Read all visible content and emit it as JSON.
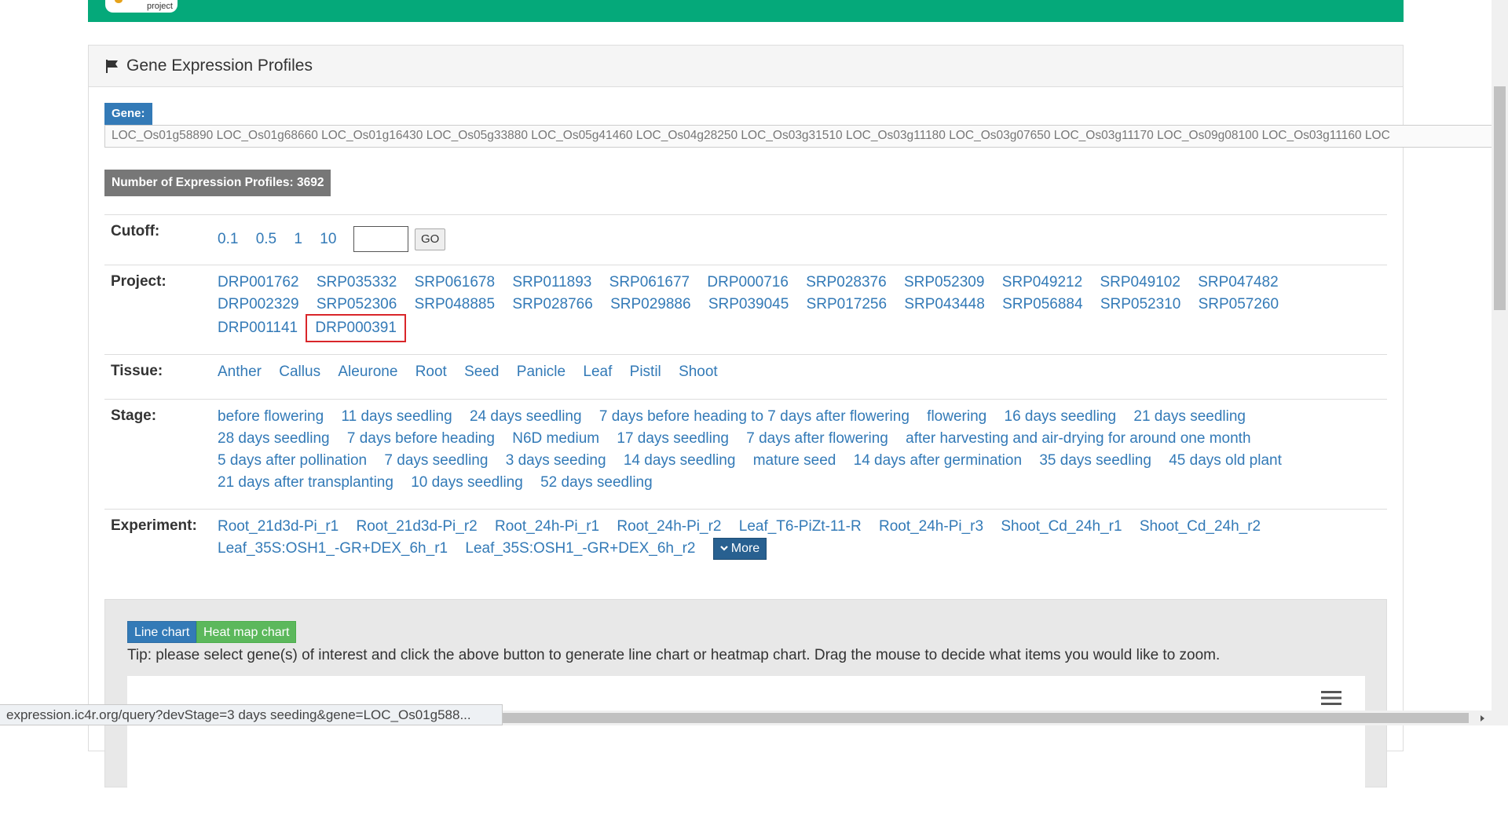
{
  "header": {
    "logo_text": "project"
  },
  "panel": {
    "title": "Gene Expression Profiles"
  },
  "gene": {
    "label": "Gene:",
    "list": "LOC_Os01g58890 LOC_Os01g68660 LOC_Os01g16430 LOC_Os05g33880 LOC_Os05g41460 LOC_Os04g28250 LOC_Os03g31510 LOC_Os03g11180 LOC_Os03g07650 LOC_Os03g11170 LOC_Os09g08100 LOC_Os03g11160 LOC"
  },
  "profiles": {
    "count_text": "Number of Expression Profiles: 3692"
  },
  "cutoff": {
    "label": "Cutoff:",
    "options": [
      "0.1",
      "0.5",
      "1",
      "10"
    ],
    "input_value": "",
    "go_label": "GO"
  },
  "project": {
    "label": "Project:",
    "items": [
      "DRP001762",
      "SRP035332",
      "SRP061678",
      "SRP011893",
      "SRP061677",
      "DRP000716",
      "SRP028376",
      "SRP052309",
      "SRP049212",
      "SRP049102",
      "SRP047482",
      "DRP002329",
      "SRP052306",
      "SRP048885",
      "SRP028766",
      "SRP029886",
      "SRP039045",
      "SRP017256",
      "SRP043448",
      "SRP056884",
      "SRP052310",
      "SRP057260",
      "DRP001141",
      "DRP000391"
    ],
    "highlighted": "DRP000391"
  },
  "tissue": {
    "label": "Tissue:",
    "items": [
      "Anther",
      "Callus",
      "Aleurone",
      "Root",
      "Seed",
      "Panicle",
      "Leaf",
      "Pistil",
      "Shoot"
    ]
  },
  "stage": {
    "label": "Stage:",
    "items": [
      "before flowering",
      "11 days seedling",
      "24 days seedling",
      "7 days before heading to 7 days after flowering",
      "flowering",
      "16 days seedling",
      "21 days seedling",
      "28 days seedling",
      "7 days before heading",
      "N6D medium",
      "17 days seedling",
      "7 days after flowering",
      "after harvesting and air-drying for around one month",
      "5 days after pollination",
      "7 days seedling",
      "3 days seeding",
      "14 days seedling",
      "mature seed",
      "14 days after germination",
      "35 days seedling",
      "45 days old plant",
      "21 days after transplanting",
      "10 days seedling",
      "52 days seedling"
    ]
  },
  "experiment": {
    "label": "Experiment:",
    "items": [
      "Root_21d3d-Pi_r1",
      "Root_21d3d-Pi_r2",
      "Root_24h-Pi_r1",
      "Root_24h-Pi_r2",
      "Leaf_T6-PiZt-11-R",
      "Root_24h-Pi_r3",
      "Shoot_Cd_24h_r1",
      "Shoot_Cd_24h_r2",
      "Leaf_35S:OSH1_-GR+DEX_6h_r1",
      "Leaf_35S:OSH1_-GR+DEX_6h_r2"
    ],
    "more_label": "More"
  },
  "chart": {
    "line_label": "Line chart",
    "heat_label": "Heat map chart",
    "tip": "Tip: please select gene(s) of interest and click the above button to generate line chart or heatmap chart. Drag the mouse to decide what items you would like to zoom."
  },
  "status": {
    "url": "expression.ic4r.org/query?devStage=3 days seeding&gene=LOC_Os01g588..."
  },
  "colors": {
    "header_green": "#05a97a",
    "link_blue": "#337ab7",
    "highlight_red": "#d9262a"
  }
}
